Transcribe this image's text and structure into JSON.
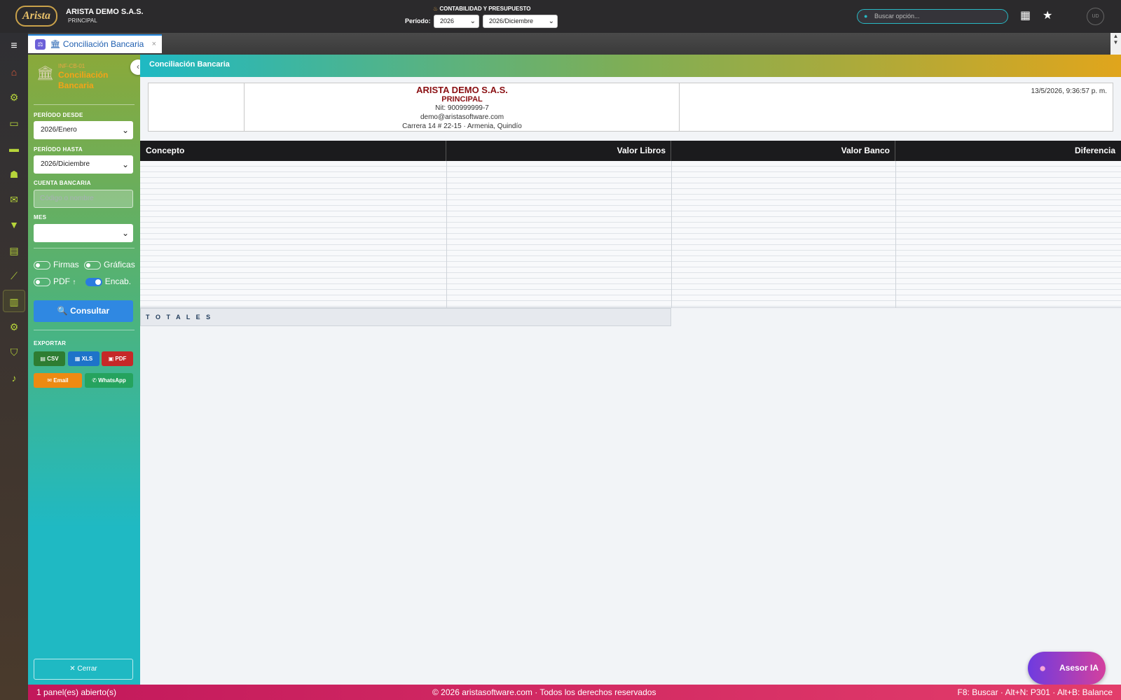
{
  "topbar": {
    "logo_text": "Arista",
    "company_name": "ARISTA DEMO S.A.S.",
    "company_branch": "PRINCIPAL",
    "module_title": "CONTABILIDAD Y PRESUPUESTO",
    "period_label": "Período:",
    "period_year": "2026",
    "period_month": "2026/Diciembre",
    "search_placeholder": "Buscar opción...",
    "avatar_initials": "UD"
  },
  "rail": {
    "items": [
      "menu-icon",
      "home-icon",
      "cogs-icon",
      "folder-open-icon",
      "folder-plus-icon",
      "users-icon",
      "envelope-icon",
      "filter-icon",
      "file-icon",
      "line-chart-icon",
      "bar-chart-icon",
      "cogs-icon",
      "shield-icon",
      "bell-icon"
    ],
    "active": "bar-chart-icon"
  },
  "tabs": [
    {
      "label": "Conciliación Bancaria",
      "active": true
    }
  ],
  "panel": {
    "code": "INF-CB-01",
    "title": "Conciliación Bancaria",
    "periodo_desde_label": "PERÍODO DESDE",
    "periodo_desde_value": "2026/Enero",
    "periodo_hasta_label": "PERÍODO HASTA",
    "periodo_hasta_value": "2026/Diciembre",
    "cuenta_label": "CUENTA BANCARIA",
    "cuenta_placeholder": "Código o nombre",
    "mes_label": "MES",
    "mes_value": "",
    "toggles": {
      "firmas": "Firmas",
      "graficas": "Gráficas",
      "pdf": "PDF",
      "encab": "Encab."
    },
    "consultar_label": "Consultar",
    "exportar_label": "EXPORTAR",
    "csv_label": "CSV",
    "xls_label": "XLS",
    "pdf_label": "PDF",
    "email_label": "Email",
    "whatsapp_label": "WhatsApp",
    "cerrar_label": "Cerrar"
  },
  "content": {
    "header_title": "Conciliación Bancaria",
    "report": {
      "company": "ARISTA DEMO S.A.S.",
      "branch": "PRINCIPAL",
      "nit": "Nit: 900999999-7",
      "email": "demo@aristasoftware.com",
      "address": "Carrera 14 # 22-15 · Armenia, Quindío",
      "datetime": "13/5/2026, 9:36:57 p. m."
    },
    "grid": {
      "columns": [
        "Concepto",
        "Valor Libros",
        "Valor Banco",
        "Diferencia"
      ],
      "rows": [],
      "totals_label": "T O T A L E S"
    }
  },
  "asesor_label": "Asesor IA",
  "footer": {
    "left": "1 panel(es) abierto(s)",
    "center": "© 2026 aristasoftware.com · Todos los derechos reservados",
    "right": "F8: Buscar · Alt+N: P301 · Alt+B: Balance"
  },
  "colors": {
    "accent_blue": "#2f88e2",
    "brand_maroon": "#8a0f12",
    "rail_green": "#b6d43a",
    "footer_pink": "#c2185b"
  }
}
